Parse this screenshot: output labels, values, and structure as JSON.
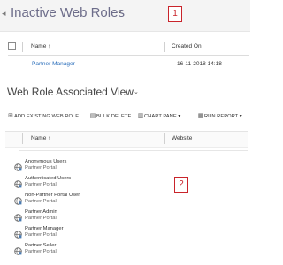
{
  "view": {
    "back_glyph": "◂",
    "title": "Inactive Web Roles",
    "chevron": "⌄",
    "callout1": "1"
  },
  "grid1": {
    "col_name": "Name ↑",
    "col_created": "Created On",
    "row": {
      "name": "Partner Manager",
      "created_on": "16-11-2018 14:18"
    }
  },
  "section": {
    "title": "Web Role Associated View",
    "chevron": "⌄"
  },
  "commands": [
    {
      "icon": "plus-icon",
      "glyph": "⊞",
      "label": "ADD EXISTING WEB ROLE"
    },
    {
      "icon": "delete-icon",
      "glyph": "▤",
      "label": "BULK DELETE"
    },
    {
      "icon": "chart-icon",
      "glyph": "▥",
      "label": "CHART PANE",
      "arrow": "▾"
    },
    {
      "icon": "report-icon",
      "glyph": "▦",
      "label": "RUN REPORT",
      "arrow": "▾"
    }
  ],
  "grid2": {
    "col_name": "Name ↑",
    "col_website": "Website",
    "callout2": "2",
    "rows": [
      {
        "name": "Anonymous Users",
        "website": "Partner Portal"
      },
      {
        "name": "Authenticated Users",
        "website": "Partner Portal"
      },
      {
        "name": "Non-Partner Portal User",
        "website": "Partner Portal"
      },
      {
        "name": "Partner Admin",
        "website": "Partner Portal"
      },
      {
        "name": "Partner Manager",
        "website": "Partner Portal"
      },
      {
        "name": "Partner Seller",
        "website": "Partner Portal"
      }
    ]
  },
  "colors": {
    "callout": "#c9242b",
    "link": "#2a6ebb",
    "title": "#6d6d8a"
  }
}
